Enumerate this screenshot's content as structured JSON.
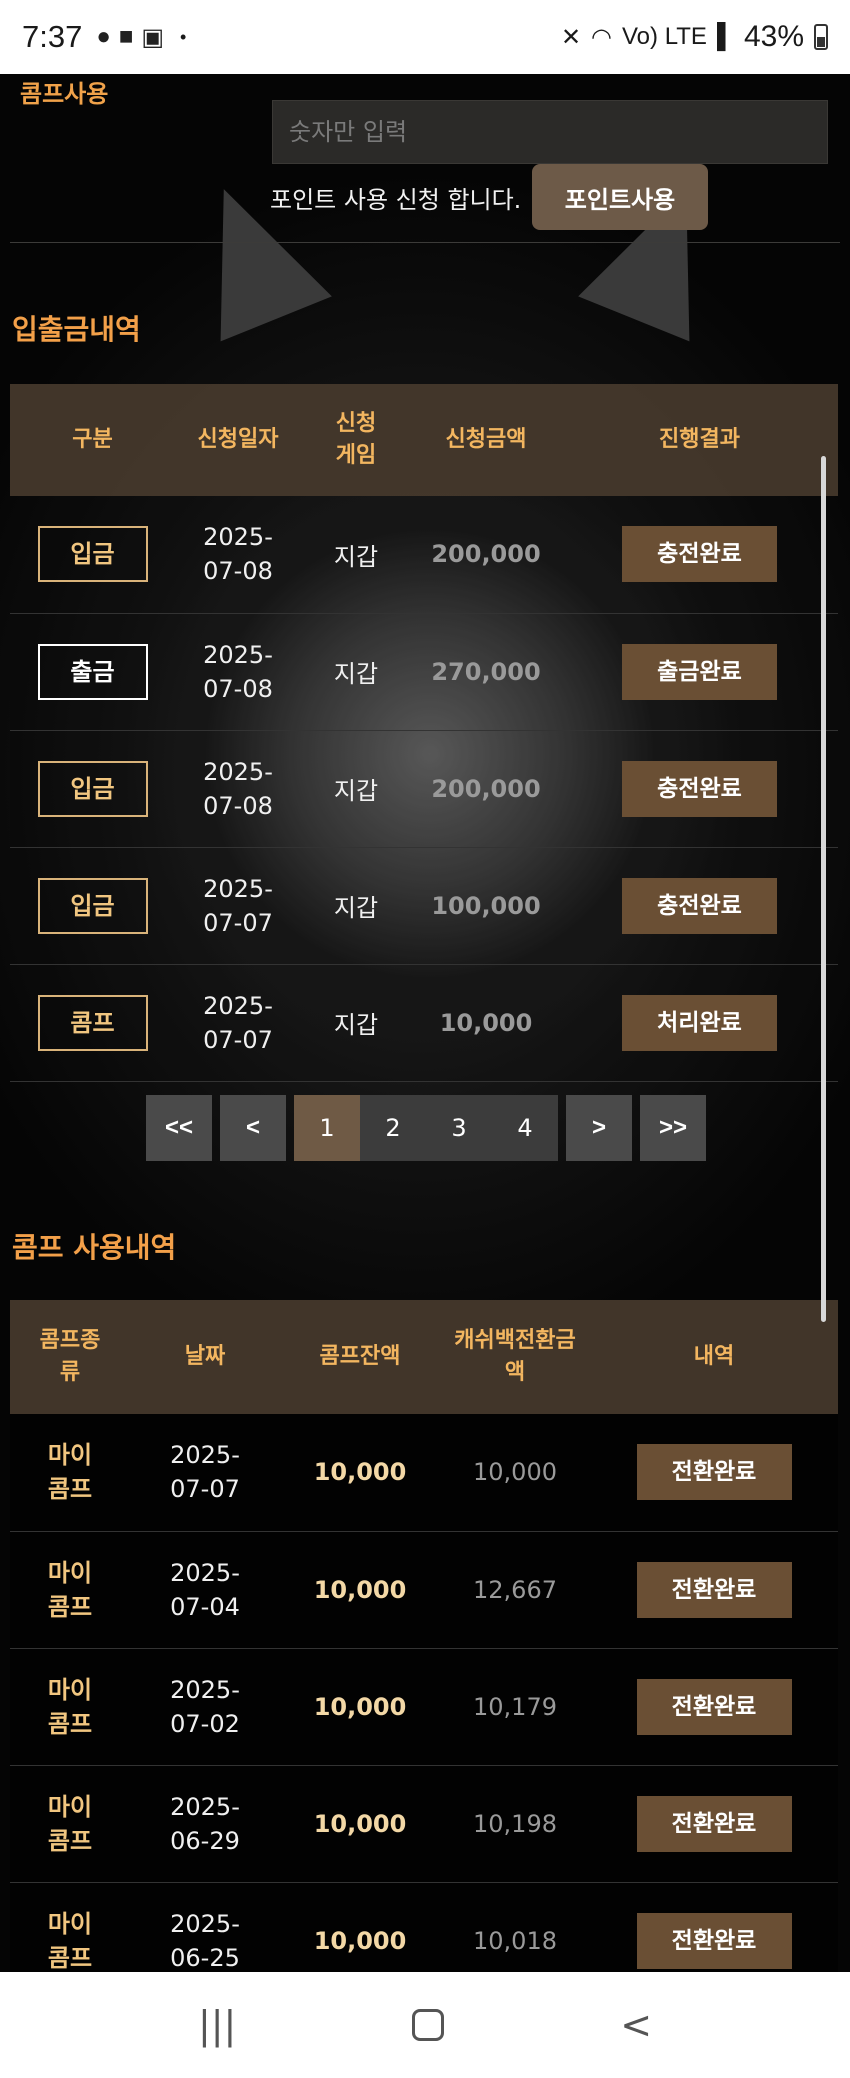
{
  "status_bar": {
    "time": "7:37",
    "notif_icons": [
      "chat-bubble-icon",
      "message-icon",
      "gallery-icon"
    ],
    "dot": "•",
    "right_icons": [
      "mute-icon",
      "wifi-icon",
      "lte-icon",
      "signal-icon"
    ],
    "lte": "Vo) LTE",
    "battery_pct": "43%"
  },
  "comp_form": {
    "label": "콤프사용",
    "input_placeholder": "숫자만 입력",
    "point_text": "포인트 사용 신청 합니다.",
    "point_button": "포인트사용"
  },
  "deposit_history": {
    "title": "입출금내역",
    "headers": [
      "구분",
      "신청일자",
      "신청게임",
      "신청금액",
      "진행결과"
    ],
    "rows": [
      {
        "type": "입금",
        "date": "2025-07-08",
        "game": "지갑",
        "amount": "200,000",
        "result": "충전완료"
      },
      {
        "type": "출금",
        "date": "2025-07-08",
        "game": "지갑",
        "amount": "270,000",
        "result": "출금완료"
      },
      {
        "type": "입금",
        "date": "2025-07-08",
        "game": "지갑",
        "amount": "200,000",
        "result": "충전완료"
      },
      {
        "type": "입금",
        "date": "2025-07-07",
        "game": "지갑",
        "amount": "100,000",
        "result": "충전완료"
      },
      {
        "type": "콤프",
        "date": "2025-07-07",
        "game": "지갑",
        "amount": "10,000",
        "result": "처리완료"
      }
    ]
  },
  "pagination": {
    "first": "<<",
    "prev": "<",
    "pages": [
      "1",
      "2",
      "3",
      "4"
    ],
    "current": "1",
    "next": ">",
    "last": ">>"
  },
  "comp_history": {
    "title": "콤프 사용내역",
    "headers": [
      "콤프종류",
      "날짜",
      "콤프잔액",
      "캐쉬백전환금액",
      "내역"
    ],
    "rows": [
      {
        "type": "마이콤프",
        "date": "2025-07-07",
        "balance": "10,000",
        "cashback": "10,000",
        "status": "전환완료"
      },
      {
        "type": "마이콤프",
        "date": "2025-07-04",
        "balance": "10,000",
        "cashback": "12,667",
        "status": "전환완료"
      },
      {
        "type": "마이콤프",
        "date": "2025-07-02",
        "balance": "10,000",
        "cashback": "10,179",
        "status": "전환완료"
      },
      {
        "type": "마이콤프",
        "date": "2025-06-29",
        "balance": "10,000",
        "cashback": "10,198",
        "status": "전환완료"
      },
      {
        "type": "마이콤프",
        "date": "2025-06-25",
        "balance": "10,000",
        "cashback": "10,018",
        "status": "전환완료"
      }
    ]
  },
  "nav_bar": {
    "recents_icon": "|||",
    "home_icon": "home-icon",
    "back_icon": "<"
  },
  "colors": {
    "accent_orange": "#f3a049",
    "header_gold": "#f3b660",
    "result_brown": "#6a4f34",
    "button_brown": "#6d5a48",
    "pager_active": "#6f5a45"
  }
}
